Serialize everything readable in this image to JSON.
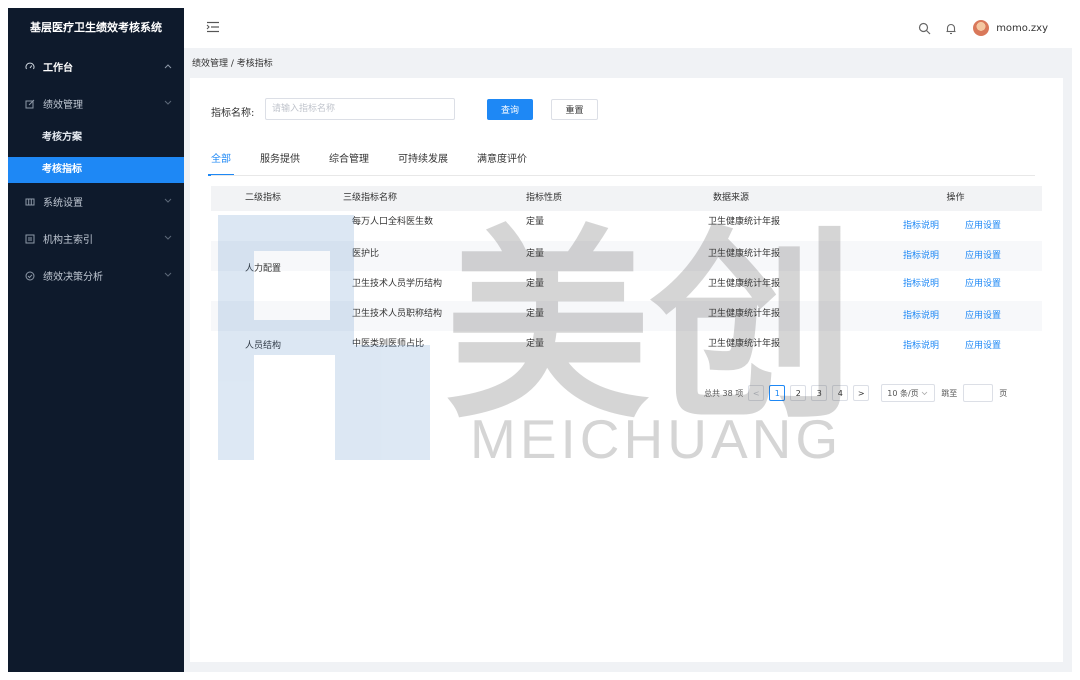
{
  "app": {
    "title": "基层医疗卫生绩效考核系统"
  },
  "sidebar": {
    "items": [
      {
        "label": "工作台",
        "icon": "dashboard-icon",
        "expanded": true
      },
      {
        "label": "绩效管理",
        "icon": "edit-icon",
        "expanded": true,
        "children": [
          {
            "label": "考核方案"
          },
          {
            "label": "考核指标",
            "selected": true
          }
        ]
      },
      {
        "label": "系统设置",
        "icon": "grid-icon"
      },
      {
        "label": "机构主索引",
        "icon": "list-icon"
      },
      {
        "label": "绩效决策分析",
        "icon": "check-circle-icon"
      }
    ]
  },
  "header": {
    "username": "momo.zxy"
  },
  "breadcrumb": "绩效管理 / 考核指标",
  "search": {
    "label": "指标名称:",
    "placeholder": "请输入指标名称",
    "value": "",
    "query_label": "查询",
    "reset_label": "重置"
  },
  "tabs": [
    {
      "label": "全部",
      "active": true
    },
    {
      "label": "服务提供"
    },
    {
      "label": "综合管理"
    },
    {
      "label": "可持续发展"
    },
    {
      "label": "满意度评价"
    }
  ],
  "table": {
    "columns": [
      "二级指标",
      "三级指标名称",
      "指标性质",
      "数据来源",
      "操作"
    ],
    "groups": [
      {
        "label": "人力配置",
        "rows": 2
      },
      {
        "label": "人员结构",
        "rows": 3
      }
    ],
    "rows": [
      {
        "name": "每万人口全科医生数",
        "nature": "定量",
        "source": "卫生健康统计年报"
      },
      {
        "name": "医护比",
        "nature": "定量",
        "source": "卫生健康统计年报"
      },
      {
        "name": "卫生技术人员学历结构",
        "nature": "定量",
        "source": "卫生健康统计年报"
      },
      {
        "name": "卫生技术人员职称结构",
        "nature": "定量",
        "source": "卫生健康统计年报"
      },
      {
        "name": "中医类别医师占比",
        "nature": "定量",
        "source": "卫生健康统计年报"
      }
    ],
    "actions": {
      "explain": "指标说明",
      "apply": "应用设置"
    }
  },
  "pagination": {
    "total_text": "总共 38 项",
    "prev": "<",
    "next": ">",
    "pages": [
      "1",
      "2",
      "3",
      "4"
    ],
    "current": "1",
    "page_size": "10 条/页",
    "jump_label": "跳至",
    "page_suffix": "页"
  },
  "watermark": {
    "text": "MEICHUANG",
    "chars": "美创"
  },
  "colors": {
    "primary": "#1e88f5",
    "sidebar": "#0e1a2c",
    "background": "#f0f2f5"
  }
}
